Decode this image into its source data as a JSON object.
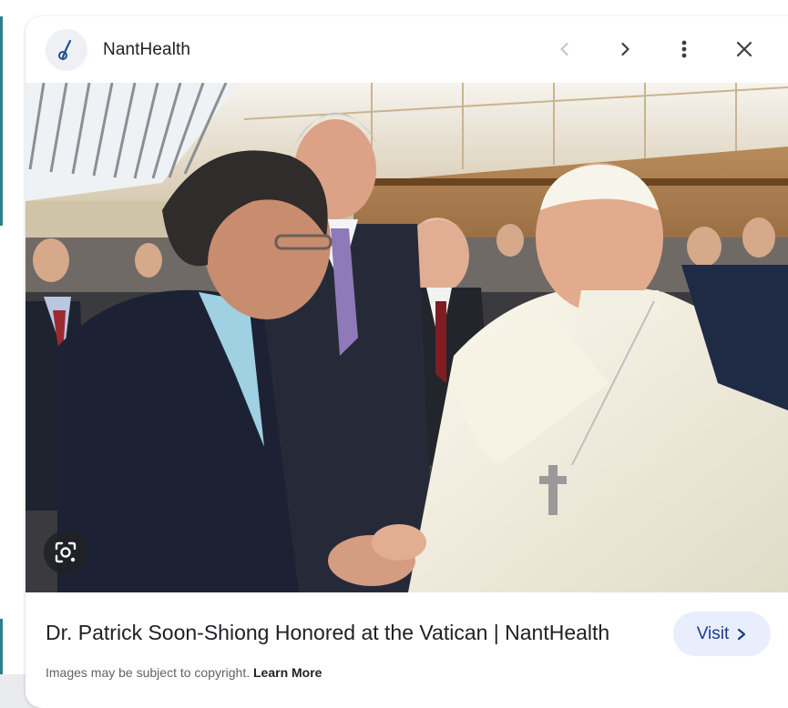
{
  "header": {
    "site_name": "NantHealth",
    "logo_icon": "nanthealth-logo-icon",
    "prev_icon": "chevron-left-icon",
    "next_icon": "chevron-right-icon",
    "more_icon": "more-vert-icon",
    "close_icon": "close-icon"
  },
  "image": {
    "lens_icon": "google-lens-icon"
  },
  "caption": {
    "title": "Dr. Patrick Soon-Shiong Honored at the Vatican | NantHealth",
    "visit_label": "Visit",
    "visit_icon": "chevron-right-icon",
    "copyright_text": "Images may be subject to copyright.",
    "learn_more": "Learn More"
  },
  "colors": {
    "accent_button_bg": "#e8eefc",
    "accent_button_text": "#1d3b8b",
    "side_stripe": "#2d7f8a"
  }
}
